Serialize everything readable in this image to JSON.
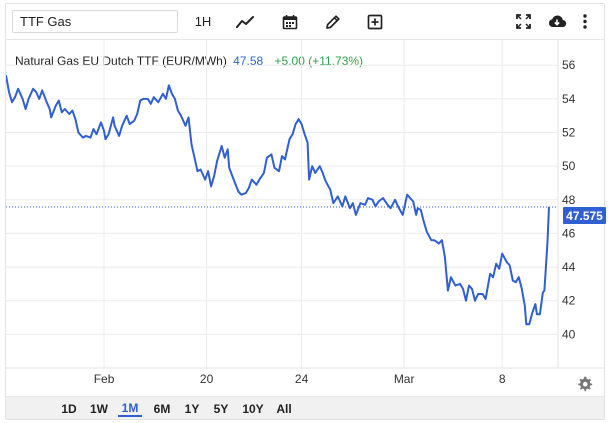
{
  "toolbar": {
    "symbol_value": "TTF Gas",
    "interval_label": "1H",
    "icons": [
      "line-chart-icon",
      "calendar-icon",
      "pencil-icon",
      "add-box-icon",
      "fullscreen-icon",
      "cloud-download-icon",
      "more-vertical-icon"
    ]
  },
  "legend": {
    "name": "Natural Gas EU Dutch TTF (EUR/MWh)",
    "price": "47.58",
    "change": "+5.00 (+11.73%)"
  },
  "price_tag": "47.575",
  "ranges": [
    {
      "label": "1D",
      "active": false
    },
    {
      "label": "1W",
      "active": false
    },
    {
      "label": "1M",
      "active": true
    },
    {
      "label": "6M",
      "active": false
    },
    {
      "label": "1Y",
      "active": false
    },
    {
      "label": "5Y",
      "active": false
    },
    {
      "label": "10Y",
      "active": false
    },
    {
      "label": "All",
      "active": false
    }
  ],
  "colors": {
    "line": "#2f5fd0",
    "positive": "#2aa14a",
    "active_range": "#2f5fd0"
  },
  "chart_data": {
    "type": "line",
    "title": "Natural Gas EU Dutch TTF (EUR/MWh)",
    "ylim": [
      38,
      57.5
    ],
    "ytick_values": [
      40,
      42,
      44,
      46,
      48,
      50,
      52,
      54,
      56
    ],
    "xlim": [
      0,
      36.6
    ],
    "xtick_labels": [
      {
        "label": "Feb",
        "x": 6.5
      },
      {
        "label": "20",
        "x": 13.3
      },
      {
        "label": "24",
        "x": 19.6
      },
      {
        "label": "Mar",
        "x": 26.4
      },
      {
        "label": "8",
        "x": 32.9
      }
    ],
    "last_value": 47.575,
    "series": [
      {
        "values": [
          [
            0.0,
            55.4
          ],
          [
            0.2,
            54.4
          ],
          [
            0.4,
            53.8
          ],
          [
            0.6,
            54.1
          ],
          [
            0.8,
            54.6
          ],
          [
            1.1,
            54.0
          ],
          [
            1.3,
            53.4
          ],
          [
            1.5,
            54.0
          ],
          [
            1.8,
            54.6
          ],
          [
            2.0,
            54.4
          ],
          [
            2.2,
            54.0
          ],
          [
            2.4,
            54.5
          ],
          [
            2.7,
            53.8
          ],
          [
            2.9,
            53.4
          ],
          [
            3.0,
            52.9
          ],
          [
            3.3,
            53.6
          ],
          [
            3.5,
            53.9
          ],
          [
            3.7,
            53.2
          ],
          [
            3.9,
            53.4
          ],
          [
            4.2,
            53.1
          ],
          [
            4.4,
            53.3
          ],
          [
            4.6,
            52.8
          ],
          [
            4.8,
            52.0
          ],
          [
            5.1,
            51.7
          ],
          [
            5.3,
            51.8
          ],
          [
            5.6,
            51.7
          ],
          [
            5.8,
            52.2
          ],
          [
            6.0,
            51.9
          ],
          [
            6.3,
            52.6
          ],
          [
            6.5,
            52.1
          ],
          [
            6.6,
            51.6
          ],
          [
            6.8,
            51.9
          ],
          [
            7.1,
            52.9
          ],
          [
            7.2,
            52.4
          ],
          [
            7.5,
            51.8
          ],
          [
            7.7,
            52.4
          ],
          [
            8.0,
            53.0
          ],
          [
            8.2,
            52.5
          ],
          [
            8.5,
            52.7
          ],
          [
            8.7,
            53.1
          ],
          [
            8.9,
            53.9
          ],
          [
            9.1,
            54.0
          ],
          [
            9.4,
            54.0
          ],
          [
            9.6,
            53.7
          ],
          [
            9.8,
            54.1
          ],
          [
            10.1,
            53.8
          ],
          [
            10.4,
            54.3
          ],
          [
            10.6,
            54.0
          ],
          [
            10.8,
            54.8
          ],
          [
            11.0,
            54.3
          ],
          [
            11.2,
            54.0
          ],
          [
            11.4,
            53.3
          ],
          [
            11.6,
            53.0
          ],
          [
            11.9,
            52.4
          ],
          [
            12.1,
            52.9
          ],
          [
            12.3,
            51.3
          ],
          [
            12.5,
            50.5
          ],
          [
            12.7,
            49.7
          ],
          [
            12.9,
            49.8
          ],
          [
            13.2,
            49.2
          ],
          [
            13.4,
            49.7
          ],
          [
            13.6,
            48.8
          ],
          [
            13.8,
            49.4
          ],
          [
            14.0,
            50.3
          ],
          [
            14.3,
            51.2
          ],
          [
            14.5,
            50.5
          ],
          [
            14.7,
            51.0
          ],
          [
            14.8,
            49.9
          ],
          [
            15.1,
            49.2
          ],
          [
            15.4,
            48.5
          ],
          [
            15.6,
            48.3
          ],
          [
            15.9,
            48.4
          ],
          [
            16.1,
            48.7
          ],
          [
            16.3,
            49.2
          ],
          [
            16.6,
            48.9
          ],
          [
            16.8,
            49.2
          ],
          [
            17.1,
            49.6
          ],
          [
            17.3,
            50.5
          ],
          [
            17.6,
            50.7
          ],
          [
            17.8,
            49.9
          ],
          [
            18.1,
            49.7
          ],
          [
            18.3,
            50.6
          ],
          [
            18.5,
            50.4
          ],
          [
            18.8,
            51.6
          ],
          [
            19.0,
            51.9
          ],
          [
            19.2,
            52.5
          ],
          [
            19.4,
            52.8
          ],
          [
            19.6,
            52.5
          ],
          [
            19.8,
            51.9
          ],
          [
            20.0,
            51.4
          ],
          [
            20.1,
            49.2
          ],
          [
            20.3,
            50.0
          ],
          [
            20.5,
            49.6
          ],
          [
            20.8,
            50.0
          ],
          [
            21.0,
            49.6
          ],
          [
            21.2,
            49.1
          ],
          [
            21.5,
            48.6
          ],
          [
            21.7,
            47.8
          ],
          [
            22.0,
            48.2
          ],
          [
            22.3,
            47.6
          ],
          [
            22.5,
            48.2
          ],
          [
            22.8,
            47.5
          ],
          [
            23.0,
            47.8
          ],
          [
            23.2,
            47.1
          ],
          [
            23.5,
            47.8
          ],
          [
            23.8,
            47.7
          ],
          [
            24.0,
            48.1
          ],
          [
            24.3,
            48.0
          ],
          [
            24.5,
            47.6
          ],
          [
            24.7,
            47.9
          ],
          [
            25.0,
            48.1
          ],
          [
            25.3,
            47.7
          ],
          [
            25.5,
            47.5
          ],
          [
            25.8,
            48.0
          ],
          [
            26.0,
            47.6
          ],
          [
            26.3,
            47.1
          ],
          [
            26.6,
            48.3
          ],
          [
            26.8,
            48.1
          ],
          [
            27.0,
            47.9
          ],
          [
            27.2,
            47.1
          ],
          [
            27.3,
            47.5
          ],
          [
            27.5,
            47.4
          ],
          [
            27.7,
            46.7
          ],
          [
            27.9,
            46.1
          ],
          [
            28.2,
            45.6
          ],
          [
            28.4,
            45.6
          ],
          [
            28.7,
            45.4
          ],
          [
            28.9,
            45.6
          ],
          [
            29.1,
            44.6
          ],
          [
            29.3,
            42.6
          ],
          [
            29.5,
            43.4
          ],
          [
            29.8,
            42.9
          ],
          [
            30.1,
            43.0
          ],
          [
            30.3,
            42.7
          ],
          [
            30.5,
            42.0
          ],
          [
            30.7,
            42.9
          ],
          [
            30.9,
            42.7
          ],
          [
            31.1,
            42.0
          ],
          [
            31.3,
            42.4
          ],
          [
            31.6,
            42.4
          ],
          [
            31.8,
            42.1
          ],
          [
            32.1,
            43.6
          ],
          [
            32.3,
            43.4
          ],
          [
            32.5,
            44.2
          ],
          [
            32.7,
            43.9
          ],
          [
            32.9,
            44.8
          ],
          [
            33.2,
            44.3
          ],
          [
            33.4,
            44.1
          ],
          [
            33.6,
            43.2
          ],
          [
            33.8,
            43.1
          ],
          [
            34.0,
            43.4
          ],
          [
            34.2,
            42.7
          ],
          [
            34.4,
            41.7
          ],
          [
            34.5,
            40.6
          ],
          [
            34.7,
            40.6
          ],
          [
            34.9,
            41.3
          ],
          [
            35.1,
            41.8
          ],
          [
            35.2,
            41.2
          ],
          [
            35.4,
            41.2
          ],
          [
            35.6,
            42.5
          ],
          [
            35.7,
            42.6
          ],
          [
            35.9,
            45.4
          ],
          [
            36.0,
            47.58
          ]
        ]
      }
    ]
  }
}
